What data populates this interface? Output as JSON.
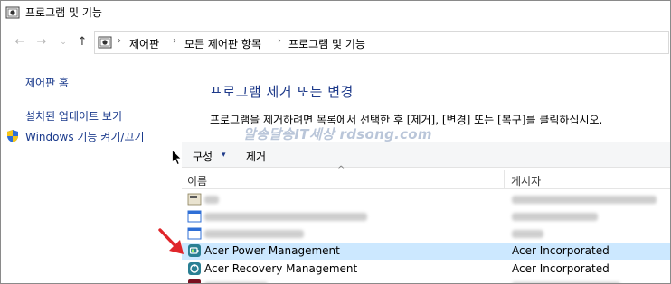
{
  "window": {
    "title": "프로그램 및 기능"
  },
  "nav": {
    "back_icon": "back-arrow-icon",
    "forward_icon": "forward-arrow-icon",
    "recent_icon": "chevron-down-icon",
    "up_icon": "up-arrow-icon",
    "breadcrumb": [
      "제어판",
      "모든 제어판 항목",
      "프로그램 및 기능"
    ]
  },
  "sidebar": {
    "home": "제어판 홈",
    "updates": "설치된 업데이트 보기",
    "features": "Windows 기능 켜기/끄기"
  },
  "main": {
    "heading": "프로그램 제거 또는 변경",
    "description": "프로그램을 제거하려면 목록에서 선택한 후 [제거], [변경] 또는 [복구]를 클릭하십시오.",
    "watermark": "알송달송IT세상 rdsong.com"
  },
  "toolbar": {
    "organize": "구성",
    "organize_caret": "▾",
    "remove": "제거"
  },
  "table": {
    "columns": {
      "name": "이름",
      "publisher": "게시자"
    },
    "rows": [
      {
        "name": "Acer Power Management",
        "publisher": "Acer Incorporated",
        "selected": true
      },
      {
        "name": "Acer Recovery Management",
        "publisher": "Acer Incorporated",
        "selected": false
      }
    ]
  },
  "colors": {
    "selected_row": "#cce8ff",
    "heading": "#1e3a8a",
    "link": "#1a3a8c",
    "annotation_arrow": "#e0262b"
  }
}
